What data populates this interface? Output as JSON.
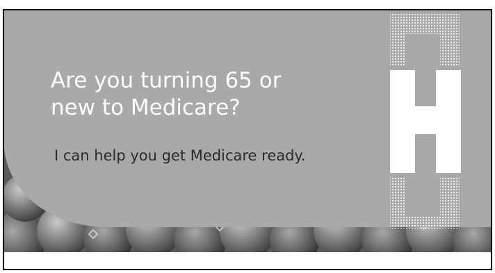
{
  "banner": {
    "headline_line1": "Are you turning 65 or",
    "headline_line2": "new to Medicare?",
    "subheadline": "I can help you get Medicare ready."
  },
  "logo": {
    "name": "h-logo-icon",
    "letter": "H"
  },
  "background": {
    "name": "blueberries-image"
  },
  "colors": {
    "panel": "#a9a9a9",
    "text_light": "#ffffff",
    "text_dark": "#2a2a2a",
    "border": "#111111"
  }
}
